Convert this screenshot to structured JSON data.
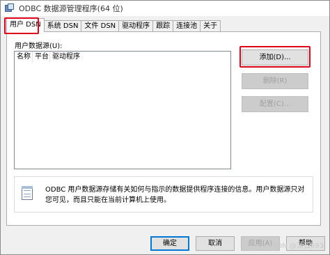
{
  "window": {
    "title": "ODBC 数据源管理程序(64 位)"
  },
  "tabs": [
    {
      "label": "用户 DSN",
      "active": true
    },
    {
      "label": "系统 DSN"
    },
    {
      "label": "文件 DSN"
    },
    {
      "label": "驱动程序"
    },
    {
      "label": "跟踪"
    },
    {
      "label": "连接池"
    },
    {
      "label": "关于"
    }
  ],
  "panel": {
    "list_label": "用户数据源(U):",
    "columns": [
      "名称",
      "平台",
      "驱动程序"
    ],
    "rows": []
  },
  "side_buttons": {
    "add": "添加(D)...",
    "remove": "删除(R)",
    "configure": "配置(C)..."
  },
  "info": {
    "icon": "data-source-icon",
    "text": "ODBC 用户数据源存储有关如何与指示的数据提供程序连接的信息。用户数据源只对您可见，而且只能在当前计算机上使用。"
  },
  "dialog_buttons": {
    "ok": "确定",
    "cancel": "取消",
    "apply": "应用(A)",
    "help": "帮助"
  },
  "watermark": "CSDN @淡云693",
  "colors": {
    "highlight": "#e0001a",
    "focus": "#0078d7"
  }
}
